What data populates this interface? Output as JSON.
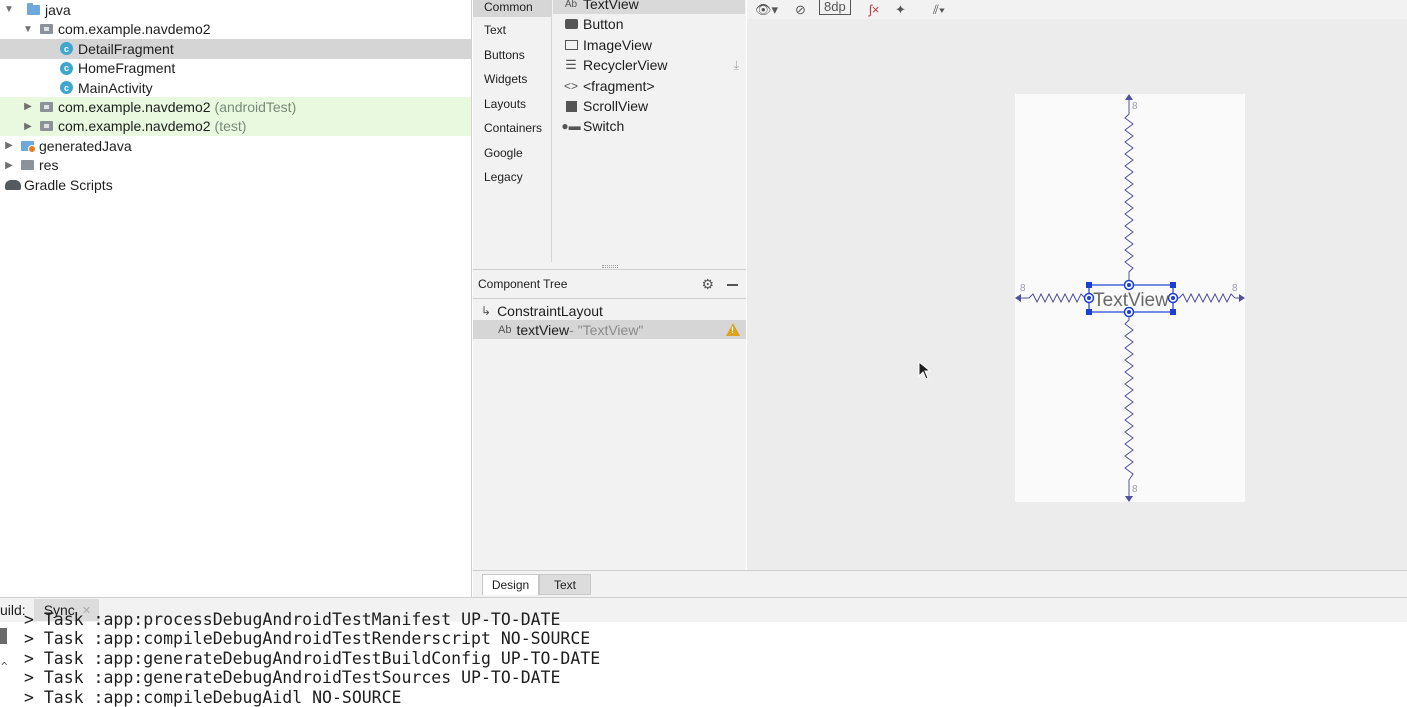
{
  "project": {
    "items": [
      {
        "label": "java",
        "suffix": ""
      },
      {
        "label": "com.example.navdemo2",
        "suffix": ""
      },
      {
        "label": "DetailFragment",
        "suffix": ""
      },
      {
        "label": "HomeFragment",
        "suffix": ""
      },
      {
        "label": "MainActivity",
        "suffix": ""
      },
      {
        "label": "com.example.navdemo2",
        "suffix": "(androidTest)"
      },
      {
        "label": "com.example.navdemo2",
        "suffix": "(test)"
      },
      {
        "label": "generatedJava",
        "suffix": ""
      },
      {
        "label": "res",
        "suffix": ""
      },
      {
        "label": "Gradle Scripts",
        "suffix": ""
      }
    ]
  },
  "palette": {
    "categories": [
      "Common",
      "Text",
      "Buttons",
      "Widgets",
      "Layouts",
      "Containers",
      "Google",
      "Legacy"
    ],
    "items": [
      {
        "label": "TextView",
        "icon": "Ab"
      },
      {
        "label": "Button",
        "icon": "button-icon"
      },
      {
        "label": "ImageView",
        "icon": "image-icon"
      },
      {
        "label": "RecyclerView",
        "icon": "list-icon"
      },
      {
        "label": "<fragment>",
        "icon": "code-icon"
      },
      {
        "label": "ScrollView",
        "icon": "scrollview-icon"
      },
      {
        "label": "Switch",
        "icon": "switch-icon"
      }
    ]
  },
  "component_tree": {
    "title": "Component Tree",
    "root": "ConstraintLayout",
    "child_icon": "Ab",
    "child_name": "textView",
    "child_text": "- \"TextView\""
  },
  "design_toolbar": {
    "margin": "8dp"
  },
  "design_surface": {
    "textview_label": "TextView",
    "margin_top": "8",
    "margin_bottom": "8",
    "margin_left": "8",
    "margin_right": "8"
  },
  "editor_tabs": [
    "Design",
    "Text"
  ],
  "build": {
    "label": "uild:",
    "tab": "Sync",
    "lines": [
      "> Task :app:processDebugAndroidTestManifest UP-TO-DATE",
      "> Task :app:compileDebugAndroidTestRenderscript NO-SOURCE",
      "> Task :app:generateDebugAndroidTestBuildConfig UP-TO-DATE",
      "> Task :app:generateDebugAndroidTestSources UP-TO-DATE",
      "> Task :app:compileDebugAidl NO-SOURCE"
    ]
  },
  "colors": {
    "selection": "#d5d5d5",
    "test_source_bg": "#e8f9e0",
    "blueprint": "#5050a0",
    "selection_blue": "#1a3fd1",
    "warning": "#e0a020"
  }
}
